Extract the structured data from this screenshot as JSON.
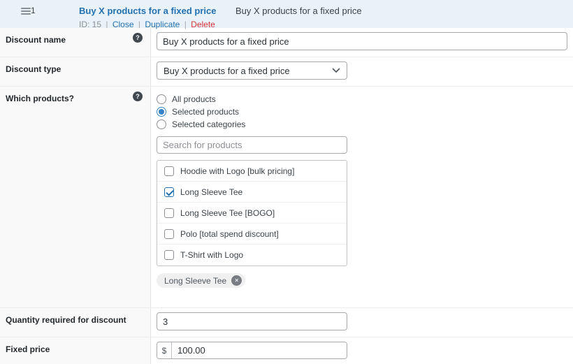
{
  "icons": {
    "help": "?",
    "close_x": "✕"
  },
  "colors": {
    "accent_blue": "#2271b1",
    "selected_blue": "#3582c4",
    "delete_red": "#d63638",
    "header_bg": "#e9f1f9",
    "left_column_bg": "#f9f9f9"
  },
  "header": {
    "rule_number": "1",
    "title": "Buy X products for a fixed price",
    "id_label": "ID: 15",
    "separator": "|",
    "close_label": "Close",
    "duplicate_label": "Duplicate",
    "delete_label": "Delete",
    "summary": "Buy X products for a fixed price"
  },
  "form": {
    "discount_name": {
      "label": "Discount name",
      "value": "Buy X products for a fixed price"
    },
    "discount_type": {
      "label": "Discount type",
      "value": "Buy X products for a fixed price"
    },
    "which_products": {
      "label": "Which products?",
      "options": [
        {
          "label": "All products",
          "selected": false
        },
        {
          "label": "Selected products",
          "selected": true
        },
        {
          "label": "Selected categories",
          "selected": false
        }
      ],
      "search_placeholder": "Search for products",
      "products": [
        {
          "label": "Hoodie with Logo [bulk pricing]",
          "checked": false
        },
        {
          "label": "Long Sleeve Tee",
          "checked": true
        },
        {
          "label": "Long Sleeve Tee [BOGO]",
          "checked": false
        },
        {
          "label": "Polo [total spend discount]",
          "checked": false
        },
        {
          "label": "T-Shirt with Logo",
          "checked": false
        }
      ],
      "selected_tags": [
        "Long Sleeve Tee"
      ]
    },
    "quantity": {
      "label": "Quantity required for discount",
      "value": "3"
    },
    "fixed_price": {
      "label": "Fixed price",
      "currency_symbol": "$",
      "value": "100.00"
    }
  }
}
